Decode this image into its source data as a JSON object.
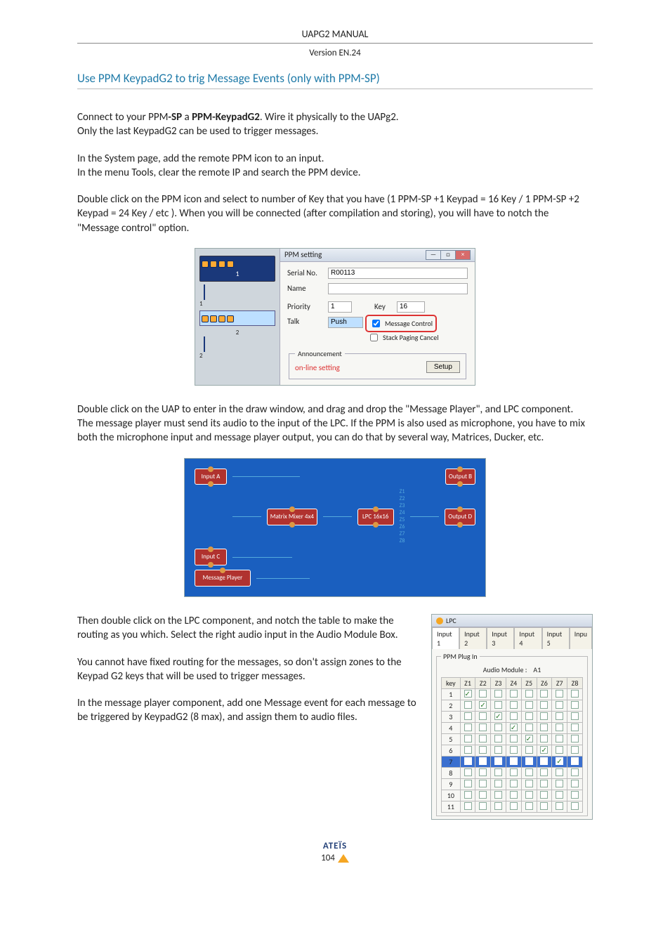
{
  "header": {
    "title": "UAPG2  MANUAL",
    "version": "Version EN.24"
  },
  "section_title": "Use PPM KeypadG2 to trig Message Events (only with PPM-SP)",
  "p1": {
    "pre": "Connect to your PPM",
    "b1": "-SP",
    "mid": "  a ",
    "b2": "PPM-KeypadG2",
    "post": ". Wire it physically to the UAPg2.",
    "line2": "Only the last KeypadG2 can be used to trigger messages."
  },
  "p2a": "In the System page, add the remote PPM icon to an input.",
  "p2b": "In the menu Tools, clear the remote IP and search the PPM device.",
  "p3": "Double click on the PPM icon and select to number of Key that you have (1 PPM-SP +1 Keypad = 16 Key  /  1 PPM-SP +2 Keypad = 24 Key / etc ). When you will be connected (after compilation and storing), you will have to notch the \"Message control\" option.",
  "ppm_dialog": {
    "title": "PPM setting",
    "serial_label": "Serial No.",
    "serial_value": "R00113",
    "name_label": "Name",
    "name_value": "",
    "priority_label": "Priority",
    "priority_value": "1",
    "key_label": "Key",
    "key_value": "16",
    "talk_label": "Talk",
    "talk_value": "Push",
    "chk_msg": "Message Control",
    "chk_stack": "Stack Paging Cancel",
    "ann_legend": "Announcement",
    "online": "on-line setting",
    "setup": "Setup",
    "win_min": "—",
    "win_max": "□",
    "win_close": "×"
  },
  "p4": "Double click on the UAP to enter in the draw window, and drag and drop the \"Message Player\", and LPC component.",
  "p4b": " The message player must send its audio to the input of the LPC. If the PPM is also used as microphone, you have to mix both the microphone input and message player output, you can do that by several way, Matrices, Ducker, etc.",
  "draw": {
    "input_a": "Input A",
    "input_c": "Input C",
    "msg_player": "Message Player",
    "matrix": "Matrix Mixer 4x4",
    "lpc": "LPC 16x16",
    "out_b": "Output B",
    "out_d": "Output D",
    "z_labels": [
      "Z1",
      "Z2",
      "Z3",
      "Z4",
      "Z5",
      "Z6",
      "Z7",
      "Z8"
    ]
  },
  "p5": "Then double click on the LPC component, and notch the table to make the routing as you which. Select the right audio input in the Audio Module Box.",
  "p6": "You cannot have fixed routing for the messages, so don't assign zones to the Keypad G2  keys that will be used to trigger messages.",
  "p7": "In the message player component, add one Message event for each message to be triggered by KeypadG2 (8 max), and assign them to audio files.",
  "lpc": {
    "title": "LPC",
    "tabs": [
      "Input 1",
      "Input 2",
      "Input 3",
      "Input 4",
      "Input 5",
      "Inpu"
    ],
    "legend": "PPM Plug In",
    "audio_module_label": "Audio Module :",
    "audio_module_value": "A1",
    "cols": [
      "key",
      "Z1",
      "Z2",
      "Z3",
      "Z4",
      "Z5",
      "Z6",
      "Z7",
      "Z8"
    ],
    "rows": [
      {
        "k": "1",
        "on": [
          1
        ]
      },
      {
        "k": "2",
        "on": [
          2
        ]
      },
      {
        "k": "3",
        "on": [
          3
        ]
      },
      {
        "k": "4",
        "on": [
          4
        ]
      },
      {
        "k": "5",
        "on": [
          5
        ]
      },
      {
        "k": "6",
        "on": [
          6
        ]
      },
      {
        "k": "7",
        "on": [
          7
        ],
        "hl": true
      },
      {
        "k": "8",
        "on": []
      },
      {
        "k": "9",
        "on": []
      },
      {
        "k": "10",
        "on": []
      },
      {
        "k": "11",
        "on": []
      }
    ]
  },
  "footer": {
    "brand": "ATEÏS",
    "page": "104"
  }
}
